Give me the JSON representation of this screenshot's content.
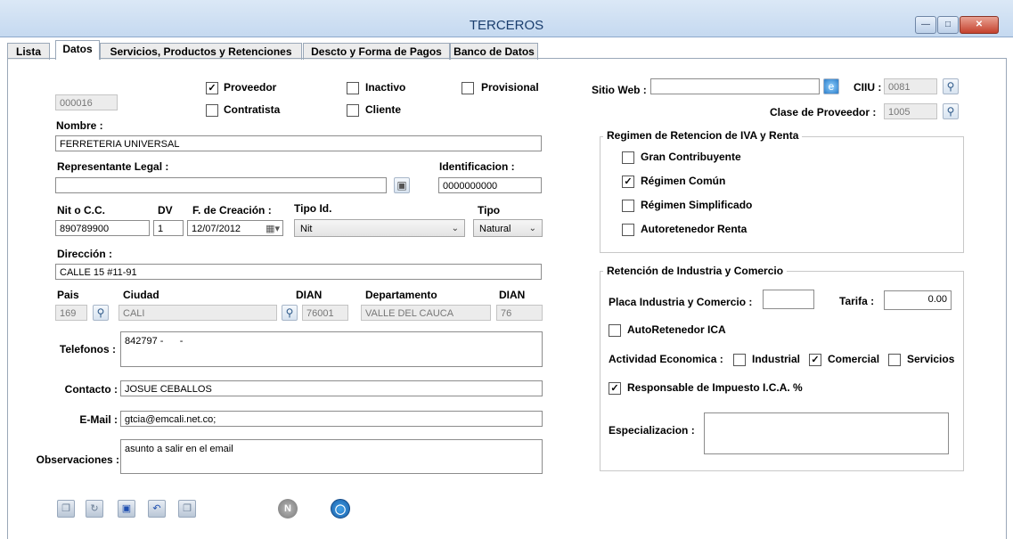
{
  "window": {
    "title": "TERCEROS"
  },
  "tabs": [
    {
      "label": "Lista",
      "active": false
    },
    {
      "label": "Datos",
      "active": true
    },
    {
      "label": "Servicios, Productos y Retenciones",
      "active": false
    },
    {
      "label": "Descto y Forma de Pagos",
      "active": false
    },
    {
      "label": "Banco de Datos",
      "active": false
    }
  ],
  "form": {
    "code": "000016",
    "checks": {
      "proveedor": {
        "label": "Proveedor",
        "checked": true
      },
      "contratista": {
        "label": "Contratista",
        "checked": false
      },
      "inactivo": {
        "label": "Inactivo",
        "checked": false
      },
      "cliente": {
        "label": "Cliente",
        "checked": false
      },
      "provisional": {
        "label": "Provisional",
        "checked": false
      }
    },
    "nombre": {
      "label": "Nombre :",
      "value": "FERRETERIA UNIVERSAL"
    },
    "representante": {
      "label": "Representante Legal :",
      "value": ""
    },
    "identificacion": {
      "label": "Identificacion :",
      "value": "0000000000"
    },
    "nit": {
      "label": "Nit o C.C.",
      "value": "890789900"
    },
    "dv": {
      "label": "DV",
      "value": "1"
    },
    "fecha": {
      "label": "F. de Creación :",
      "value": "12/07/2012"
    },
    "tipo_id": {
      "label": "Tipo Id.",
      "value": "Nit"
    },
    "tipo": {
      "label": "Tipo",
      "value": "Natural"
    },
    "direccion": {
      "label": "Dirección :",
      "value": "CALLE 15 #11-91"
    },
    "pais": {
      "label": "Pais",
      "value": "169"
    },
    "ciudad": {
      "label": "Ciudad",
      "value": "CALI"
    },
    "dian1": {
      "label": "DIAN",
      "value": "76001"
    },
    "departamento": {
      "label": "Departamento",
      "value": "VALLE DEL CAUCA"
    },
    "dian2": {
      "label": "DIAN",
      "value": "76"
    },
    "telefonos": {
      "label": "Telefonos :",
      "value": "842797 -      -"
    },
    "contacto": {
      "label": "Contacto :",
      "value": "JOSUE CEBALLOS"
    },
    "email": {
      "label": "E-Mail :",
      "value": "gtcia@emcali.net.co;"
    },
    "observaciones": {
      "label": "Observaciones :",
      "value": "asunto a salir en el email"
    }
  },
  "right": {
    "sitio_web": {
      "label": "Sitio Web :",
      "value": ""
    },
    "ciiu": {
      "label": "CIIU :",
      "value": "0081"
    },
    "clase_proveedor": {
      "label": "Clase de Proveedor :",
      "value": "1005"
    },
    "regimen": {
      "title": "Regimen de Retencion de IVA y Renta",
      "options": [
        {
          "label": "Gran Contribuyente",
          "checked": false
        },
        {
          "label": "Régimen Común",
          "checked": true
        },
        {
          "label": "Régimen Simplificado",
          "checked": false
        },
        {
          "label": "Autoretenedor Renta",
          "checked": false
        }
      ]
    },
    "ica": {
      "title": "Retención de Industria y Comercio",
      "placa_label": "Placa Industria y Comercio :",
      "placa_value": "",
      "tarifa_label": "Tarifa :",
      "tarifa_value": "0.00",
      "autoretenedor": {
        "label": "AutoRetenedor ICA",
        "checked": false
      },
      "actividad_label": "Actividad Economica :",
      "industrial": {
        "label": "Industrial",
        "checked": false
      },
      "comercial": {
        "label": "Comercial",
        "checked": true
      },
      "servicios": {
        "label": "Servicios",
        "checked": false
      },
      "responsable": {
        "label": "Responsable de Impuesto I.C.A. %",
        "checked": true
      },
      "especializacion_label": "Especializacion :",
      "especializacion_value": ""
    }
  },
  "toolbar": {
    "new_icon_letter": "N"
  },
  "icons": [
    "minimize-icon",
    "maximize-icon",
    "close-icon",
    "camera-icon",
    "calendar-icon",
    "search-icon",
    "globe-icon",
    "save-icon",
    "undo-icon",
    "copy-icon",
    "refresh-icon"
  ]
}
